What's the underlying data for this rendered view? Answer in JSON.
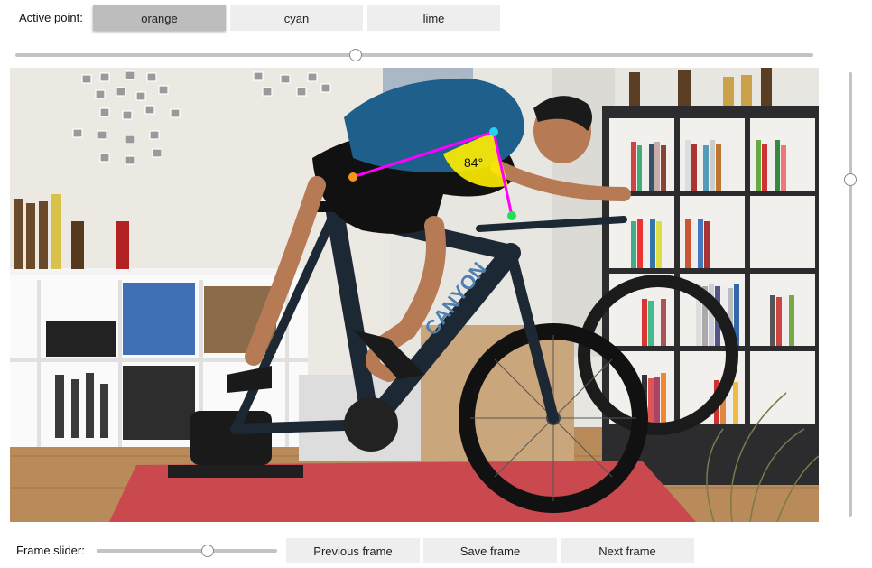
{
  "header": {
    "active_point_label": "Active point:",
    "point_buttons": [
      {
        "label": "orange",
        "active": true
      },
      {
        "label": "cyan",
        "active": false
      },
      {
        "label": "lime",
        "active": false
      }
    ]
  },
  "overlay": {
    "angle_label": "84°",
    "colors": {
      "orange": "#f7941d",
      "cyan": "#22d3ee",
      "lime": "#22dd55",
      "line": "#ff00ff",
      "arc": "#ffee00"
    }
  },
  "sliders": {
    "top_slider_value": 0.5,
    "vertical_slider_value": 0.24,
    "frame_slider_value": 0.62
  },
  "footer": {
    "frame_slider_label": "Frame slider:",
    "previous_label": "Previous frame",
    "save_label": "Save frame",
    "next_label": "Next frame"
  }
}
